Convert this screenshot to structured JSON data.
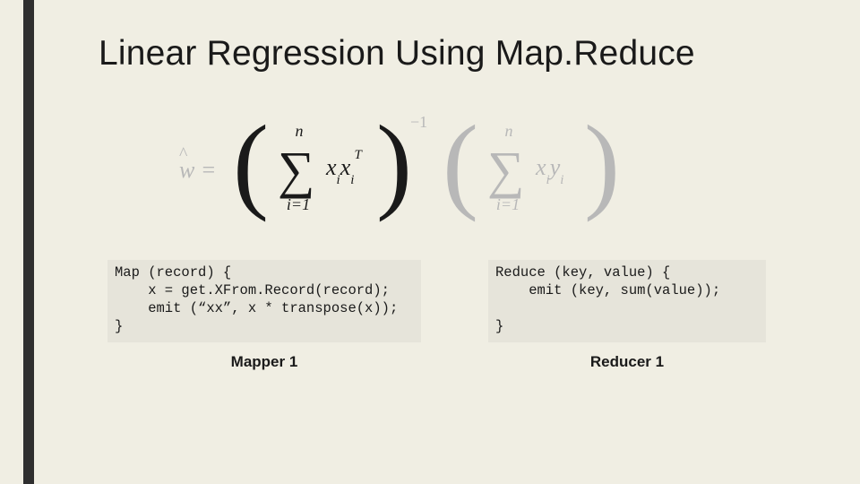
{
  "title": "Linear Regression Using Map.Reduce",
  "formula": {
    "lhs_var": "w",
    "lhs_eq": " = ",
    "sum1": {
      "upper": "n",
      "lower": "i=1",
      "term_x1": "x",
      "term_sub1": "i",
      "term_x2": "x",
      "term_sub2": "i",
      "term_sup": "T"
    },
    "exp1": "−1",
    "sum2": {
      "upper": "n",
      "lower": "i=1",
      "term_x1": "x",
      "term_sub1": "i",
      "term_y": "y",
      "term_sub2": "i"
    }
  },
  "mapper": {
    "line1": "Map (record) {",
    "line2": "    x = get.XFrom.Record(record);",
    "line3": "    emit (“xx”, x * transpose(x));",
    "line4": "}",
    "caption": "Mapper 1"
  },
  "reducer": {
    "line1": "Reduce (key, value) {",
    "line2": "    emit (key, sum(value));",
    "line3": "",
    "line4": "}",
    "caption": "Reducer 1"
  }
}
